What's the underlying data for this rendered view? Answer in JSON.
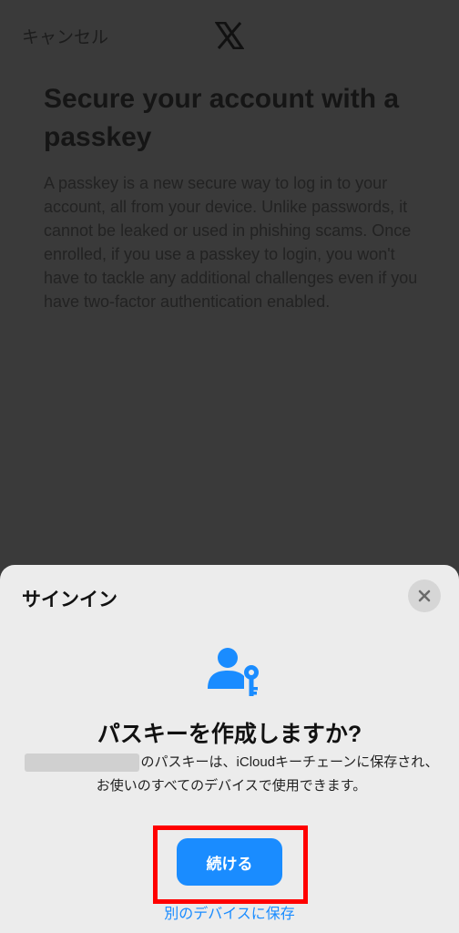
{
  "background": {
    "cancel_label": "キャンセル",
    "logo_icon": "x-logo-icon",
    "title": "Secure your account with a passkey",
    "description": "A passkey is a new secure way to log in to your account, all from your device. Unlike passwords, it cannot be leaked or used in phishing scams. Once enrolled, if you use a passkey to login, you won't have to tackle any additional challenges even if you have two-factor authentication enabled."
  },
  "sheet": {
    "title": "サインイン",
    "close_icon": "close-icon",
    "heading": "パスキーを作成しますか?",
    "description_suffix": "のパスキーは、iCloudキーチェーンに保存され、お使いのすべてのデバイスで使用できます。",
    "continue_label": "続ける",
    "other_device_label": "別のデバイスに保存"
  },
  "colors": {
    "accent": "#1a8cff",
    "highlight": "#ff0000",
    "overlay": "#3a3a3a",
    "sheet_bg": "#ececec"
  }
}
